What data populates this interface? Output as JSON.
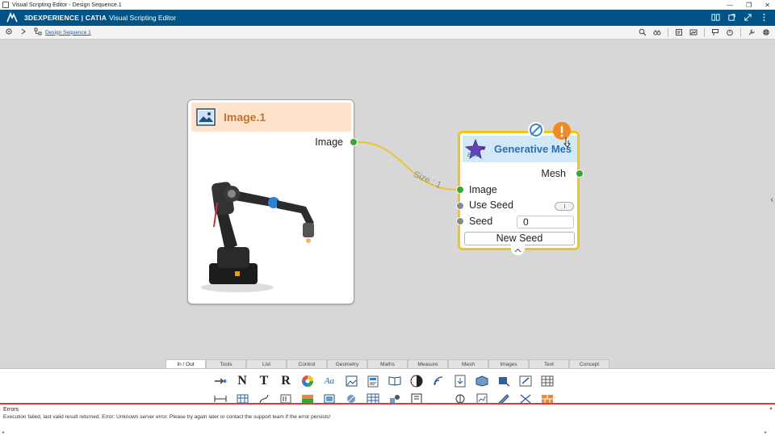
{
  "window": {
    "title": "Visual Scripting Editor - Design Sequence.1",
    "controls": [
      "—",
      "❐",
      "✕"
    ]
  },
  "appbar": {
    "brand": "3DEXPERIENCE | CATIA",
    "app_name": "Visual Scripting Editor"
  },
  "toolbar": {
    "breadcrumb": "Design Sequence 1"
  },
  "nodes": {
    "image": {
      "title": "Image.1",
      "output_port": "Image"
    },
    "generative": {
      "title": "Generative Mes",
      "beta": "Beta",
      "output_port": "Mesh",
      "inputs": {
        "image": "Image",
        "use_seed": "Use Seed",
        "seed": "Seed"
      },
      "seed_value": "0",
      "new_seed_label": "New Seed"
    },
    "link_label": "Size : 1"
  },
  "palette": {
    "tabs": [
      "In / Out",
      "Tools",
      "List",
      "Control",
      "Geometry",
      "Maths",
      "Measure",
      "Mesh",
      "Images",
      "Text",
      "Concept"
    ],
    "active_tab": "In / Out"
  },
  "errors": {
    "title": "Errors",
    "message": "Execution failed, last valid result returned. Error: Unknown server error. Please try again later or contact the support team if the error persists!"
  },
  "colors": {
    "app_header": "#005386",
    "image_node_header": "#fde3cc",
    "image_node_title": "#c27327",
    "generative_node_border": "#f2c51d",
    "generative_node_header": "#d3e8f7",
    "port_connected": "#3aa63a",
    "port_unconnected": "#8a8a8a",
    "warning": "#f08a24",
    "error_line": "#e03b3b"
  }
}
